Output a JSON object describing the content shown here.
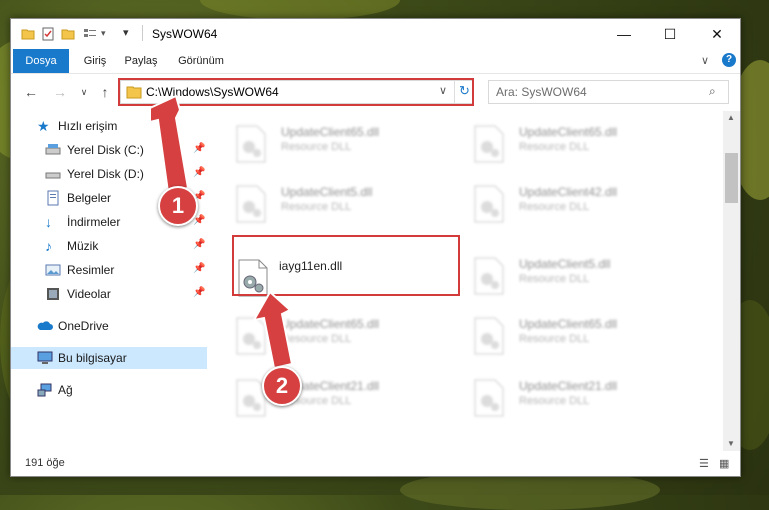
{
  "window": {
    "title": "SysWOW64"
  },
  "ribbon": {
    "tabs": [
      "Dosya",
      "Giriş",
      "Paylaş",
      "Görünüm"
    ]
  },
  "address": {
    "path": "C:\\Windows\\SysWOW64"
  },
  "search": {
    "placeholder": "Ara: SysWOW64"
  },
  "sidebar": {
    "items": [
      {
        "label": "Hızlı erişim",
        "icon": "star-icon",
        "pinned": false
      },
      {
        "label": "Yerel Disk (C:)",
        "icon": "drive-icon",
        "pinned": true
      },
      {
        "label": "Yerel Disk (D:)",
        "icon": "drive-icon",
        "pinned": true
      },
      {
        "label": "Belgeler",
        "icon": "documents-icon",
        "pinned": true
      },
      {
        "label": "İndirmeler",
        "icon": "download-icon",
        "pinned": true
      },
      {
        "label": "Müzik",
        "icon": "music-icon",
        "pinned": true
      },
      {
        "label": "Resimler",
        "icon": "pictures-icon",
        "pinned": true
      },
      {
        "label": "Videolar",
        "icon": "videos-icon",
        "pinned": true
      },
      {
        "label": "OneDrive",
        "icon": "cloud-icon",
        "pinned": false
      },
      {
        "label": "Bu bilgisayar",
        "icon": "computer-icon",
        "pinned": false
      },
      {
        "label": "Ağ",
        "icon": "network-icon",
        "pinned": false
      }
    ]
  },
  "files": [
    {
      "name": "UpdateClient65.dll",
      "type": "Resource DLL"
    },
    {
      "name": "UpdateClient65.dll",
      "type": "Resource DLL"
    },
    {
      "name": "UpdateClient5.dll",
      "type": "Resource DLL"
    },
    {
      "name": "UpdateClient42.dll",
      "type": "Resource DLL"
    },
    {
      "name": "iayg11en.dll",
      "type": ""
    },
    {
      "name": "UpdateClient5.dll",
      "type": "Resource DLL"
    },
    {
      "name": "UpdateClient65.dll",
      "type": "Resource DLL"
    },
    {
      "name": "UpdateClient65.dll",
      "type": "Resource DLL"
    },
    {
      "name": "UpdateClient21.dll",
      "type": "Resource DLL"
    },
    {
      "name": "UpdateClient21.dll",
      "type": "Resource DLL"
    }
  ],
  "status": {
    "count": "191 öğe"
  },
  "annotations": {
    "badge1": "1",
    "badge2": "2"
  },
  "colors": {
    "accent": "#1979ca",
    "highlight": "#d33b3b",
    "selected": "#cce8ff"
  }
}
